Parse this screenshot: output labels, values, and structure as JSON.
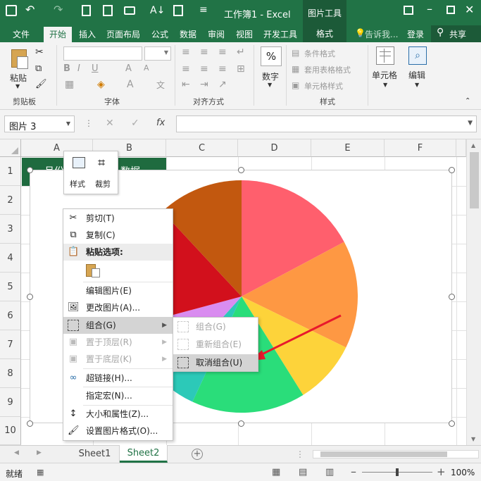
{
  "titlebar": {
    "title": "工作簿1 - Excel",
    "context_tool": "图片工具",
    "login": "登录",
    "share": "共享",
    "tell_me": "告诉我...",
    "context_tab": "格式"
  },
  "tabs": [
    "文件",
    "开始",
    "插入",
    "页面布局",
    "公式",
    "数据",
    "审阅",
    "视图",
    "开发工具"
  ],
  "ribbon": {
    "groups": {
      "clipboard": "剪贴板",
      "font": "字体",
      "alignment": "对齐方式",
      "styles": "样式"
    },
    "paste": "粘贴",
    "bold": "B",
    "italic": "I",
    "underline": "U",
    "number": "数字",
    "cells": "单元格",
    "editing": "编辑",
    "conditional_format": "条件格式",
    "table_format": "套用表格格式",
    "cell_styles": "单元格样式",
    "percent": "%"
  },
  "formula_bar": {
    "name_box": "图片 3",
    "fx": "fx"
  },
  "columns": [
    "A",
    "B",
    "C",
    "D",
    "E",
    "F"
  ],
  "rows": [
    "1",
    "2",
    "3",
    "4",
    "5",
    "6",
    "7",
    "8",
    "9",
    "10"
  ],
  "cells": {
    "a1": "月份",
    "b1": "数据"
  },
  "mini_toolbar": {
    "style": "样式",
    "crop": "裁剪"
  },
  "context_menu": {
    "cut": "剪切(T)",
    "copy": "复制(C)",
    "paste_options": "粘贴选项:",
    "edit_picture": "编辑图片(E)",
    "change_picture": "更改图片(A)...",
    "group": "组合(G)",
    "bring_front": "置于顶层(R)",
    "send_back": "置于底层(K)",
    "hyperlink": "超链接(H)...",
    "assign_macro": "指定宏(N)...",
    "size_props": "大小和属性(Z)...",
    "format_picture": "设置图片格式(O)..."
  },
  "submenu": {
    "group": "组合(G)",
    "regroup": "重新组合(E)",
    "ungroup": "取消组合(U)"
  },
  "sheets": [
    "Sheet1",
    "Sheet2"
  ],
  "status": {
    "ready": "就绪",
    "zoom": "100%"
  },
  "pie": {
    "colors": [
      "#ff5f6d",
      "#fe9843",
      "#fdd33a",
      "#2add7a",
      "#2cc9b8",
      "#d98cf0",
      "#d2101c",
      "#c2580f"
    ]
  }
}
